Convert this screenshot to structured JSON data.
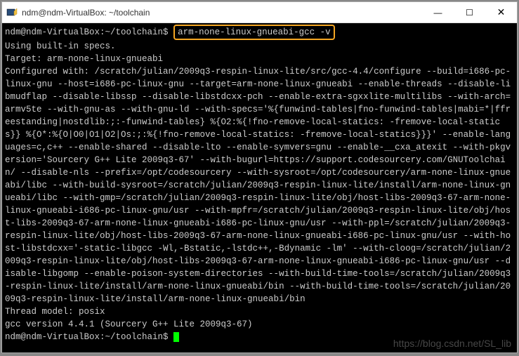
{
  "titlebar": {
    "title": "ndm@ndm-VirtualBox: ~/toolchain"
  },
  "window_controls": {
    "minimize": "—",
    "maximize": "☐",
    "close": "✕"
  },
  "terminal": {
    "prompt1": "ndm@ndm-VirtualBox:~/toolchain$",
    "command": "arm-none-linux-gnueabi-gcc -v",
    "line1": "Using built-in specs.",
    "line2": "Target: arm-none-linux-gnueabi",
    "config_block": "Configured with: /scratch/julian/2009q3-respin-linux-lite/src/gcc-4.4/configure --build=i686-pc-linux-gnu --host=i686-pc-linux-gnu --target=arm-none-linux-gnueabi --enable-threads --disable-libmudflap --disable-libssp --disable-libstdcxx-pch --enable-extra-sgxxlite-multilibs --with-arch=armv5te --with-gnu-as --with-gnu-ld --with-specs='%{funwind-tables|fno-funwind-tables|mabi=*|ffreestanding|nostdlib:;:-funwind-tables} %{O2:%{!fno-remove-local-statics: -fremove-local-statics}} %{O*:%{O|O0|O1|O2|Os:;:%{!fno-remove-local-statics: -fremove-local-statics}}}' --enable-languages=c,c++ --enable-shared --disable-lto --enable-symvers=gnu --enable-__cxa_atexit --with-pkgversion='Sourcery G++ Lite 2009q3-67' --with-bugurl=https://support.codesourcery.com/GNUToolchain/ --disable-nls --prefix=/opt/codesourcery --with-sysroot=/opt/codesourcery/arm-none-linux-gnueabi/libc --with-build-sysroot=/scratch/julian/2009q3-respin-linux-lite/install/arm-none-linux-gnueabi/libc --with-gmp=/scratch/julian/2009q3-respin-linux-lite/obj/host-libs-2009q3-67-arm-none-linux-gnueabi-i686-pc-linux-gnu/usr --with-mpfr=/scratch/julian/2009q3-respin-linux-lite/obj/host-libs-2009q3-67-arm-none-linux-gnueabi-i686-pc-linux-gnu/usr --with-ppl=/scratch/julian/2009q3-respin-linux-lite/obj/host-libs-2009q3-67-arm-none-linux-gnueabi-i686-pc-linux-gnu/usr --with-host-libstdcxx='-static-libgcc -Wl,-Bstatic,-lstdc++,-Bdynamic -lm' --with-cloog=/scratch/julian/2009q3-respin-linux-lite/obj/host-libs-2009q3-67-arm-none-linux-gnueabi-i686-pc-linux-gnu/usr --disable-libgomp --enable-poison-system-directories --with-build-time-tools=/scratch/julian/2009q3-respin-linux-lite/install/arm-none-linux-gnueabi/bin --with-build-time-tools=/scratch/julian/2009q3-respin-linux-lite/install/arm-none-linux-gnueabi/bin",
    "thread_model": "Thread model: posix",
    "gcc_version": "gcc version 4.4.1 (Sourcery G++ Lite 2009q3-67)",
    "prompt2": "ndm@ndm-VirtualBox:~/toolchain$"
  },
  "watermark": "https://blog.csdn.net/SL_lib"
}
